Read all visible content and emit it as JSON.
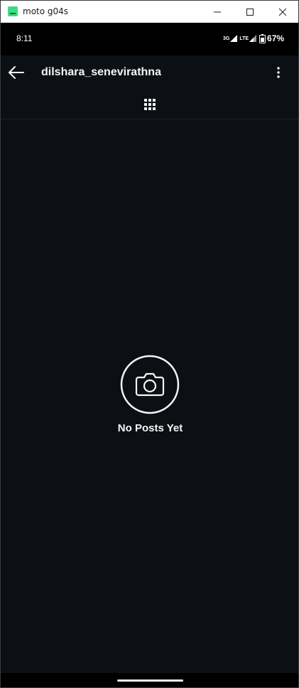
{
  "window": {
    "title": "moto g04s",
    "minimize_icon": "minimize-icon",
    "maximize_icon": "maximize-icon",
    "close_icon": "close-icon"
  },
  "status_bar": {
    "time": "8:11",
    "network_3g": "3G",
    "network_lte": "LTE",
    "battery": "67%"
  },
  "header": {
    "username": "dilshara_senevirathna",
    "back_icon": "arrow-left-icon",
    "options_icon": "more-vertical-icon"
  },
  "tabs": {
    "grid_icon": "grid-icon"
  },
  "empty_state": {
    "icon": "camera-icon",
    "message": "No Posts Yet"
  },
  "colors": {
    "background": "#0c1014",
    "text": "#f5f5f5",
    "status_bar": "#000000"
  }
}
